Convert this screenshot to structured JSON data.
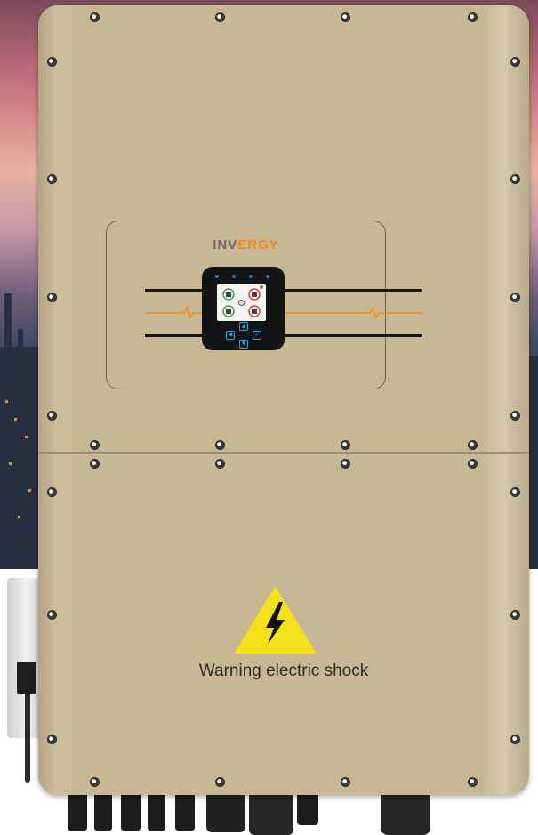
{
  "product": {
    "brand_part1": "INV",
    "brand_part2": "ERGY",
    "warning_text": "Warning electric shock"
  },
  "colors": {
    "body": "#c7b893",
    "brand_orange": "#f08a1c",
    "warning_yellow": "#f3e21a",
    "display_bg": "#121416",
    "key_blue": "#28a6e0"
  },
  "icons": {
    "warning": "high-voltage-warning-icon",
    "keys": [
      "up-arrow-icon",
      "left-arrow-icon",
      "enter-icon",
      "down-arrow-icon"
    ]
  }
}
